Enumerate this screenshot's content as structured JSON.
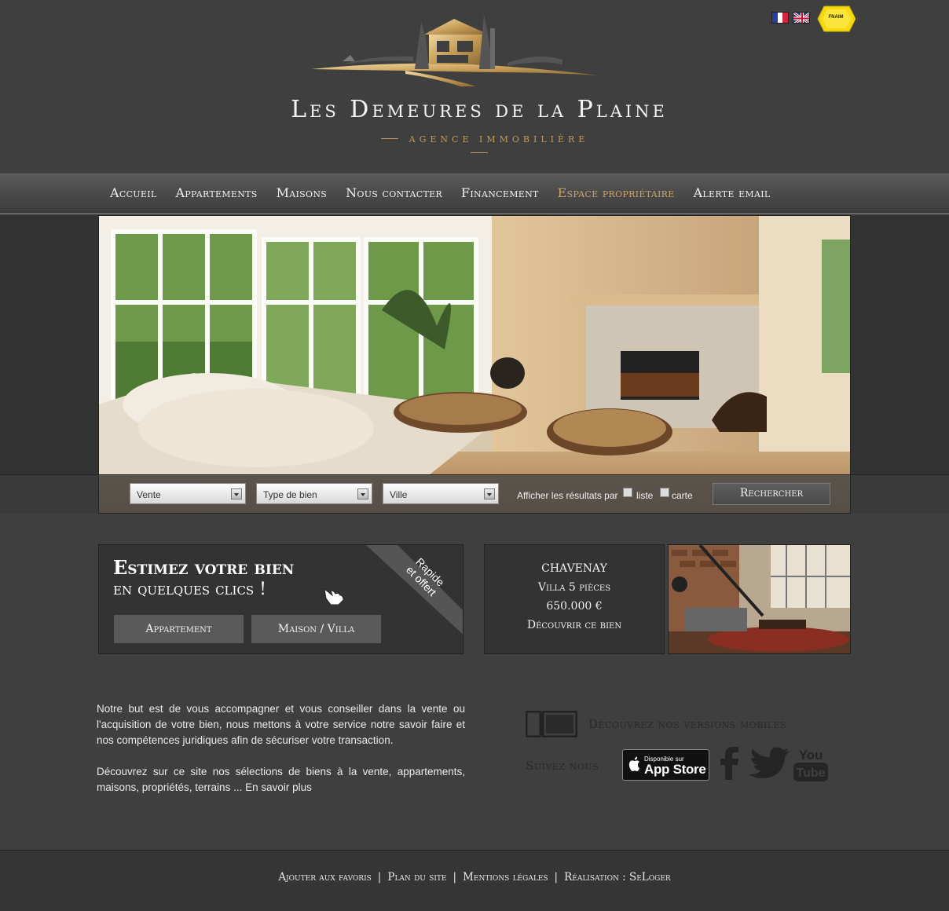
{
  "header": {
    "logo_title": "Les Demeures de la Plaine",
    "logo_subtitle": "Agence immobilière",
    "languages": [
      {
        "name": "french-flag-icon"
      },
      {
        "name": "english-flag-icon"
      }
    ],
    "badge": "FNAIM"
  },
  "nav": {
    "items": [
      {
        "label": "Accueil"
      },
      {
        "label": "Appartements"
      },
      {
        "label": "Maisons"
      },
      {
        "label": "Nous contacter"
      },
      {
        "label": "Financement"
      },
      {
        "label": "Espace propriétaire",
        "active": true
      },
      {
        "label": "Alerte email"
      }
    ]
  },
  "search": {
    "transaction": "Vente",
    "property_type": "Type de bien",
    "city": "Ville",
    "results_label": "Afficher les résultats par",
    "option_list": "liste",
    "option_map": "carte",
    "button": "Rechercher"
  },
  "estimate": {
    "line1": "Estimez votre bien",
    "line2": "en quelques clics !",
    "ribbon_line1": "Rapide",
    "ribbon_line2": "et offert",
    "btn_apartment": "Appartement",
    "btn_house": "Maison / Villa"
  },
  "featured": {
    "city": "CHAVENAY",
    "type": "Villa 5 pièces",
    "price": "650.000 €",
    "link": "Découvrir ce bien"
  },
  "intro": {
    "paragraph1": "Notre but est de vous accompagner et vous conseiller dans la vente ou l'acquisition de votre bien, nous mettons à votre service notre savoir faire et nos compétences juridiques afin de sécuriser votre transaction.",
    "paragraph2": "Découvrez sur ce site nos sélections de biens à la vente, appartements, maisons, propriétés, terrains ... En savoir plus"
  },
  "social": {
    "mobile_label": "Découvrez nos versions mobiles",
    "follow_label": "Suivez nous",
    "appstore_top": "Disponible sur",
    "appstore_main": "App Store",
    "youtube_line1": "You",
    "youtube_line2": "Tube"
  },
  "footer": {
    "links": [
      "Ajouter aux favoris",
      "Plan du site",
      "Mentions légales",
      "Réalisation : SeLoger"
    ],
    "separator": "|"
  },
  "colors": {
    "background": "#3f3f3f",
    "accent_gold": "#c9a46a",
    "dark_panel": "#333333"
  }
}
